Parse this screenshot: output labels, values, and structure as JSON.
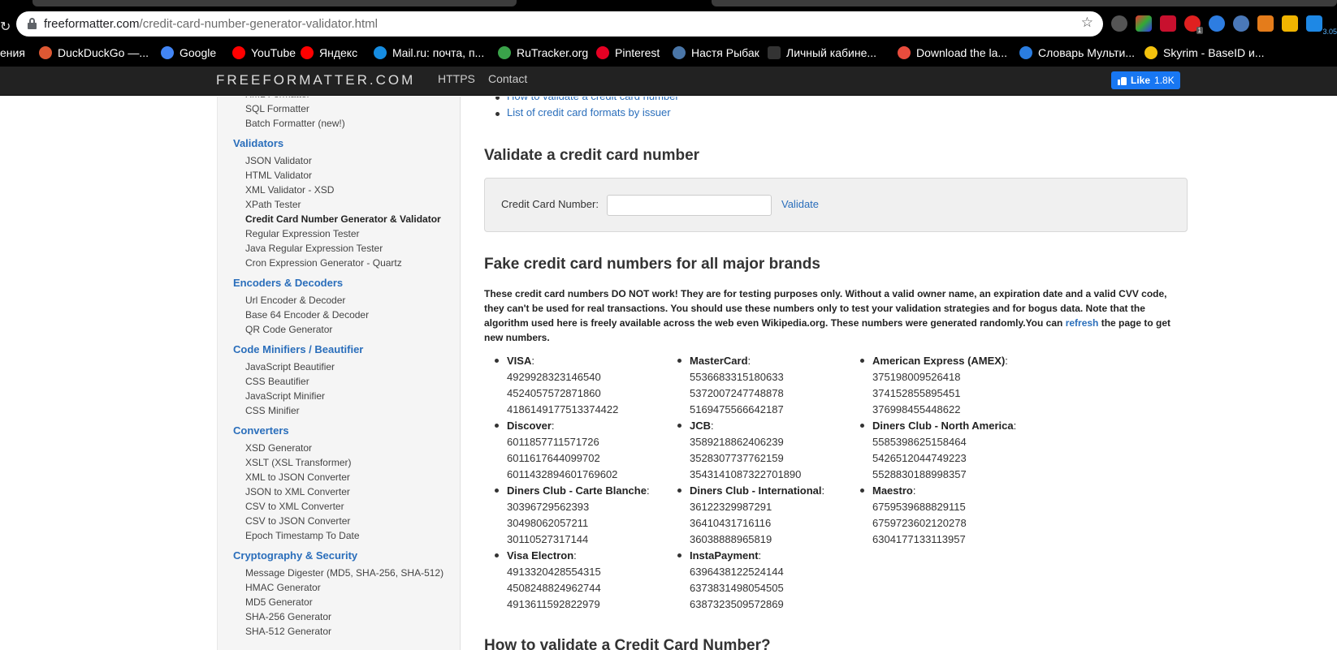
{
  "browser": {
    "url_host": "freeformatter.com",
    "url_path": "/credit-card-number-generator-validator.html",
    "extension_badge": "3.05",
    "extension_count": "1"
  },
  "bookmarks": [
    {
      "label": "ения",
      "color": "#000000"
    },
    {
      "label": "DuckDuckGo —...",
      "color": "#de5833"
    },
    {
      "label": "Google",
      "color": "#4285f4"
    },
    {
      "label": "YouTube",
      "color": "#ff0000"
    },
    {
      "label": "Яндекс",
      "color": "#ff0000"
    },
    {
      "label": "Mail.ru: почта, п...",
      "color": "#168de2"
    },
    {
      "label": "RuTracker.org",
      "color": "#3aa34a"
    },
    {
      "label": "Pinterest",
      "color": "#e60023"
    },
    {
      "label": "Настя Рыбак",
      "color": "#4a76a8"
    },
    {
      "label": "Личный кабине...",
      "color": "#333333"
    },
    {
      "label": "Download the la...",
      "color": "#e84c3d"
    },
    {
      "label": "Словарь Мульти...",
      "color": "#2a7de1"
    },
    {
      "label": "Skyrim - BaseID и...",
      "color": "#f4c20d"
    }
  ],
  "navbar": {
    "brand": "FREEFORMATTER.COM",
    "links": [
      "HTTPS",
      "Contact"
    ],
    "like_label": "Like",
    "like_count": "1.8K"
  },
  "sidebar": {
    "top_items": [
      "XML Formatter",
      "SQL Formatter",
      "Batch Formatter (new!)"
    ],
    "sections": [
      {
        "title": "Validators",
        "items": [
          "JSON Validator",
          "HTML Validator",
          "XML Validator - XSD",
          "XPath Tester",
          "Credit Card Number Generator & Validator",
          "Regular Expression Tester",
          "Java Regular Expression Tester",
          "Cron Expression Generator - Quartz"
        ]
      },
      {
        "title": "Encoders & Decoders",
        "items": [
          "Url Encoder & Decoder",
          "Base 64 Encoder & Decoder",
          "QR Code Generator"
        ]
      },
      {
        "title": "Code Minifiers / Beautifier",
        "items": [
          "JavaScript Beautifier",
          "CSS Beautifier",
          "JavaScript Minifier",
          "CSS Minifier"
        ]
      },
      {
        "title": "Converters",
        "items": [
          "XSD Generator",
          "XSLT (XSL Transformer)",
          "XML to JSON Converter",
          "JSON to XML Converter",
          "CSV to XML Converter",
          "CSV to JSON Converter",
          "Epoch Timestamp To Date"
        ]
      },
      {
        "title": "Cryptography & Security",
        "items": [
          "Message Digester (MD5, SHA-256, SHA-512)",
          "HMAC Generator",
          "MD5 Generator",
          "SHA-256 Generator",
          "SHA-512 Generator"
        ]
      }
    ]
  },
  "main": {
    "toc": [
      "How to validate a credit card number",
      "List of credit card formats by issuer"
    ],
    "validate_heading": "Validate a credit card number",
    "cc_label": "Credit Card Number:",
    "cc_value": "",
    "validate_button": "Validate",
    "fake_heading": "Fake credit card numbers for all major brands",
    "note_text": "These credit card numbers DO NOT work! They are for testing purposes only. Without a valid owner name, an expiration date and a valid CVV code, they can't be used for real transactions. You should use these numbers only to test your validation strategies and for bogus data. Note that the algorithm used here is freely available across the web even Wikipedia.org. These numbers were generated randomly.You can ",
    "note_link": "refresh",
    "note_tail": " the page to get new numbers.",
    "brand_columns": [
      [
        {
          "name": "VISA",
          "numbers": [
            "4929928323146540",
            "4524057572871860",
            "4186149177513374422"
          ]
        },
        {
          "name": "Discover",
          "numbers": [
            "6011857711571726",
            "6011617644099702",
            "6011432894601769602"
          ]
        },
        {
          "name": "Diners Club - Carte Blanche",
          "numbers": [
            "30396729562393",
            "30498062057211",
            "30110527317144"
          ]
        },
        {
          "name": "Visa Electron",
          "numbers": [
            "4913320428554315",
            "4508248824962744",
            "4913611592822979"
          ]
        }
      ],
      [
        {
          "name": "MasterCard",
          "numbers": [
            "5536683315180633",
            "5372007247748878",
            "5169475566642187"
          ]
        },
        {
          "name": "JCB",
          "numbers": [
            "3589218862406239",
            "3528307737762159",
            "3543141087322701890"
          ]
        },
        {
          "name": "Diners Club - International",
          "numbers": [
            "36122329987291",
            "36410431716116",
            "36038888965819"
          ]
        },
        {
          "name": "InstaPayment",
          "numbers": [
            "6396438122524144",
            "6373831498054505",
            "6387323509572869"
          ]
        }
      ],
      [
        {
          "name": "American Express (AMEX)",
          "numbers": [
            "375198009526418",
            "374152855895451",
            "376998455448622"
          ]
        },
        {
          "name": "Diners Club - North America",
          "numbers": [
            "5585398625158464",
            "5426512044749223",
            "5528830188998357"
          ]
        },
        {
          "name": "Maestro",
          "numbers": [
            "6759539688829115",
            "6759723602120278",
            "6304177133113957"
          ]
        }
      ]
    ],
    "next_heading": "How to validate a Credit Card Number?"
  }
}
